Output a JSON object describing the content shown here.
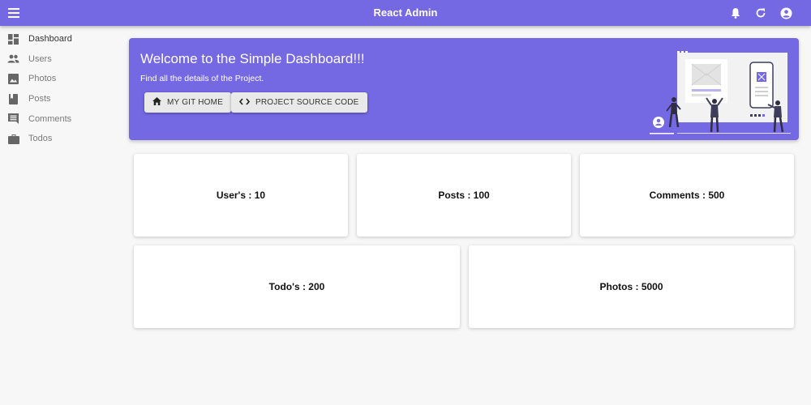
{
  "appbar": {
    "title": "React Admin",
    "menu_icon": "menu-icon",
    "actions": [
      "bell-icon",
      "refresh-icon",
      "account-icon"
    ]
  },
  "sidebar": {
    "items": [
      {
        "label": "Dashboard",
        "icon": "dashboard-icon",
        "active": true
      },
      {
        "label": "Users",
        "icon": "users-icon"
      },
      {
        "label": "Photos",
        "icon": "photo-icon"
      },
      {
        "label": "Posts",
        "icon": "book-icon"
      },
      {
        "label": "Comments",
        "icon": "comment-icon"
      },
      {
        "label": "Todos",
        "icon": "briefcase-icon"
      }
    ]
  },
  "banner": {
    "title": "Welcome to the Simple Dashboard!!!",
    "subtitle": "Find all the details of the Project.",
    "buttons": [
      {
        "label": "MY GIT HOME",
        "icon": "home-icon"
      },
      {
        "label": "PROJECT SOURCE CODE",
        "icon": "code-icon"
      }
    ]
  },
  "cards": [
    {
      "label": "User's : 10"
    },
    {
      "label": "Posts : 100"
    },
    {
      "label": "Comments : 500"
    },
    {
      "label": "Todo's : 200"
    },
    {
      "label": "Photos : 5000"
    }
  ],
  "colors": {
    "primary": "#7468e3",
    "background": "#f7f7f7",
    "card": "#ffffff"
  }
}
